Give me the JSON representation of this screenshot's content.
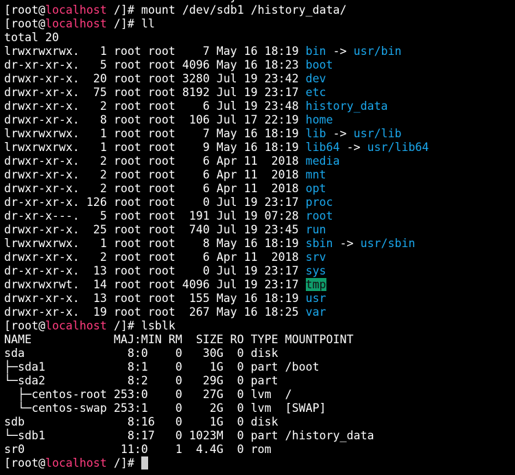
{
  "prompt": {
    "user": "[root@",
    "host": "localhost",
    "path": " /]# "
  },
  "colors": {
    "host": "#ff3c7e",
    "directory": "#1aa7ec",
    "sticky_bg": "#0f9d6b",
    "cursor": "#cfcfcf"
  },
  "lines": [
    {
      "type": "text",
      "text": "drwxr-xr-x.  19 root root  267 May 16 18:25 var"
    },
    {
      "type": "prompt",
      "command": "mount /dev/sdb1 /history_data/"
    },
    {
      "type": "prompt",
      "command": "ll"
    },
    {
      "type": "text",
      "text": "total 20"
    },
    {
      "type": "ls",
      "meta": "lrwxrwxrwx.   1 root root    7 May 16 18:19 ",
      "name": "bin",
      "target": "usr/bin"
    },
    {
      "type": "ls",
      "meta": "dr-xr-xr-x.   5 root root 4096 May 16 18:23 ",
      "name": "boot"
    },
    {
      "type": "ls",
      "meta": "drwxr-xr-x.  20 root root 3280 Jul 19 23:42 ",
      "name": "dev"
    },
    {
      "type": "ls",
      "meta": "drwxr-xr-x.  75 root root 8192 Jul 19 23:17 ",
      "name": "etc"
    },
    {
      "type": "ls",
      "meta": "drwxr-xr-x.   2 root root    6 Jul 19 23:48 ",
      "name": "history_data"
    },
    {
      "type": "ls",
      "meta": "drwxr-xr-x.   8 root root  106 Jul 17 22:19 ",
      "name": "home"
    },
    {
      "type": "ls",
      "meta": "lrwxrwxrwx.   1 root root    7 May 16 18:19 ",
      "name": "lib",
      "target": "usr/lib"
    },
    {
      "type": "ls",
      "meta": "lrwxrwxrwx.   1 root root    9 May 16 18:19 ",
      "name": "lib64",
      "target": "usr/lib64"
    },
    {
      "type": "ls",
      "meta": "drwxr-xr-x.   2 root root    6 Apr 11  2018 ",
      "name": "media"
    },
    {
      "type": "ls",
      "meta": "drwxr-xr-x.   2 root root    6 Apr 11  2018 ",
      "name": "mnt"
    },
    {
      "type": "ls",
      "meta": "drwxr-xr-x.   2 root root    6 Apr 11  2018 ",
      "name": "opt"
    },
    {
      "type": "ls",
      "meta": "dr-xr-xr-x. 126 root root    0 Jul 19 23:17 ",
      "name": "proc"
    },
    {
      "type": "ls",
      "meta": "dr-xr-x---.   5 root root  191 Jul 19 07:28 ",
      "name": "root"
    },
    {
      "type": "ls",
      "meta": "drwxr-xr-x.  25 root root  740 Jul 19 23:45 ",
      "name": "run"
    },
    {
      "type": "ls",
      "meta": "lrwxrwxrwx.   1 root root    8 May 16 18:19 ",
      "name": "sbin",
      "target": "usr/sbin"
    },
    {
      "type": "ls",
      "meta": "drwxr-xr-x.   2 root root    6 Apr 11  2018 ",
      "name": "srv"
    },
    {
      "type": "ls",
      "meta": "dr-xr-xr-x.  13 root root    0 Jul 19 23:17 ",
      "name": "sys"
    },
    {
      "type": "ls",
      "meta": "drwxrwxrwt.  14 root root 4096 Jul 19 23:17 ",
      "name": "tmp",
      "sticky": true
    },
    {
      "type": "ls",
      "meta": "drwxr-xr-x.  13 root root  155 May 16 18:19 ",
      "name": "usr"
    },
    {
      "type": "ls",
      "meta": "drwxr-xr-x.  19 root root  267 May 16 18:25 ",
      "name": "var"
    },
    {
      "type": "prompt",
      "command": "lsblk"
    },
    {
      "type": "text",
      "text": "NAME            MAJ:MIN RM  SIZE RO TYPE MOUNTPOINT"
    },
    {
      "type": "text",
      "text": "sda               8:0    0   30G  0 disk "
    },
    {
      "type": "text",
      "text": "├─sda1            8:1    0    1G  0 part /boot"
    },
    {
      "type": "text",
      "text": "└─sda2            8:2    0   29G  0 part "
    },
    {
      "type": "text",
      "text": "  ├─centos-root 253:0    0   27G  0 lvm  /"
    },
    {
      "type": "text",
      "text": "  └─centos-swap 253:1    0    2G  0 lvm  [SWAP]"
    },
    {
      "type": "text",
      "text": "sdb               8:16   0    1G  0 disk "
    },
    {
      "type": "text",
      "text": "└─sdb1            8:17   0 1023M  0 part /history_data"
    },
    {
      "type": "text",
      "text": "sr0              11:0    1  4.4G  0 rom  "
    },
    {
      "type": "prompt",
      "command": "",
      "cursor": true
    }
  ]
}
